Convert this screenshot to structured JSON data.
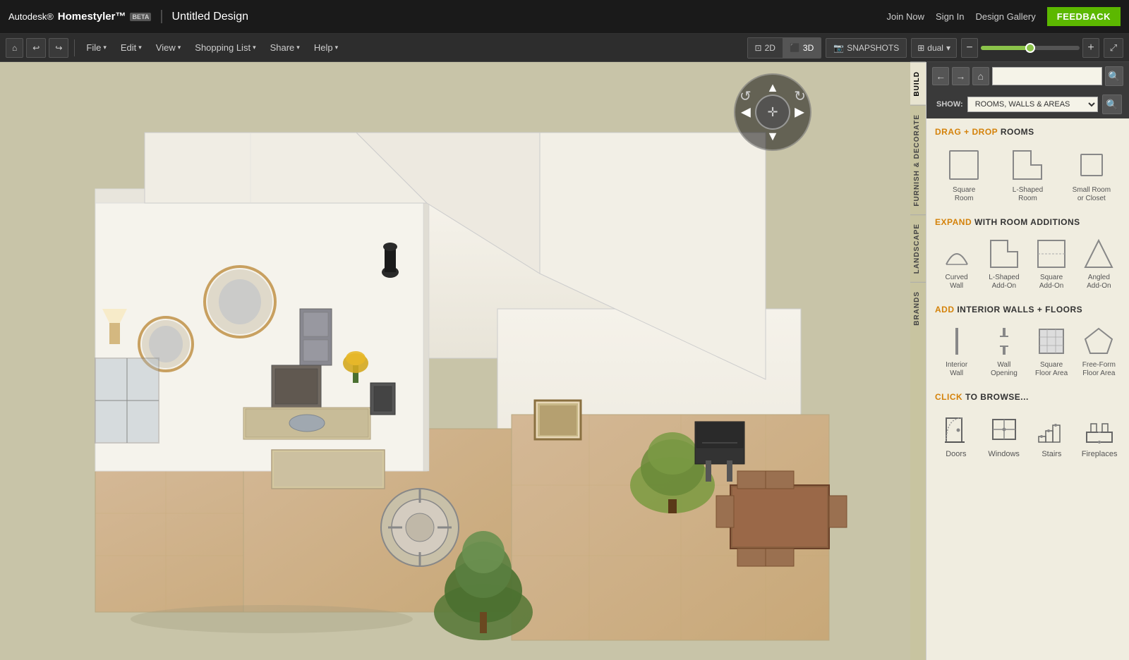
{
  "app": {
    "title": "Autodesk® Homestyler™",
    "beta_label": "BETA",
    "design_title": "Untitled Design",
    "top_links": {
      "join_now": "Join Now",
      "sign_in": "Sign In",
      "design_gallery": "Design Gallery",
      "feedback": "FEEDBACK"
    }
  },
  "toolbar": {
    "file_label": "File",
    "edit_label": "Edit",
    "view_label": "View",
    "shopping_list_label": "Shopping List",
    "share_label": "Share",
    "help_label": "Help",
    "view_2d": "2D",
    "view_3d": "3D",
    "snapshots": "SNAPSHOTS",
    "dual": "dual"
  },
  "sidebar": {
    "tabs": [
      {
        "id": "build",
        "label": "BUILD"
      },
      {
        "id": "furnish",
        "label": "FURNISH & DECORATE"
      },
      {
        "id": "landscape",
        "label": "LANDSCAPE"
      },
      {
        "id": "brands",
        "label": "BRANDS"
      }
    ],
    "show_label": "SHOW:",
    "show_option": "ROOMS, WALLS & AREAS",
    "sections": {
      "drag_drop": {
        "prefix": "DRAG + DROP",
        "suffix": "ROOMS",
        "rooms": [
          {
            "id": "square-room",
            "label": "Square\nRoom"
          },
          {
            "id": "l-shaped-room",
            "label": "L-Shaped\nRoom"
          },
          {
            "id": "small-room",
            "label": "Small Room\nor Closet"
          }
        ]
      },
      "expand": {
        "prefix": "EXPAND",
        "suffix": "WITH ROOM ADDITIONS",
        "items": [
          {
            "id": "curved-wall",
            "label": "Curved Wall"
          },
          {
            "id": "l-shaped-addon",
            "label": "L-Shaped\nAdd-On"
          },
          {
            "id": "square-addon",
            "label": "Square\nAdd-On"
          },
          {
            "id": "angled-addon",
            "label": "Angled\nAdd-On"
          }
        ]
      },
      "interior": {
        "prefix": "ADD",
        "suffix": "INTERIOR WALLS + FLOORS",
        "items": [
          {
            "id": "interior-wall",
            "label": "Interior\nWall"
          },
          {
            "id": "wall-opening",
            "label": "Wall\nOpening"
          },
          {
            "id": "square-floor",
            "label": "Square\nFloor Area"
          },
          {
            "id": "freeform-floor",
            "label": "Free-Form\nFloor Area"
          }
        ]
      },
      "browse": {
        "prefix": "CLICK",
        "suffix": "TO BROWSE...",
        "items": [
          {
            "id": "doors",
            "label": "Doors"
          },
          {
            "id": "windows",
            "label": "Windows"
          },
          {
            "id": "stairs",
            "label": "Stairs"
          },
          {
            "id": "fireplaces",
            "label": "Fireplaces"
          }
        ]
      }
    }
  }
}
